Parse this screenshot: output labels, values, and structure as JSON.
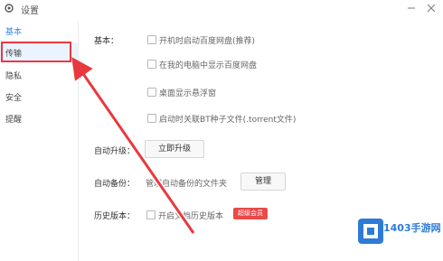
{
  "window": {
    "title": "设置"
  },
  "sidebar": {
    "items": [
      {
        "label": "基本"
      },
      {
        "label": "传输"
      },
      {
        "label": "隐私"
      },
      {
        "label": "安全"
      },
      {
        "label": "提醒"
      }
    ]
  },
  "basic": {
    "label": "基本：",
    "options": [
      {
        "text": "开机时启动百度网盘(推荐)"
      },
      {
        "text": "在我的电脑中显示百度网盘"
      },
      {
        "text": "桌面显示悬浮窗"
      },
      {
        "text": "启动时关联BT种子文件(.torrent文件)"
      }
    ]
  },
  "auto_upgrade": {
    "label": "自动升级：",
    "button": "立即升级"
  },
  "auto_backup": {
    "label": "自动备份：",
    "text": "管理自动备份的文件夹",
    "button": "管理"
  },
  "history": {
    "label": "历史版本：",
    "option": "开启文档历史版本",
    "tag": "超级会员"
  },
  "watermark": {
    "text": "1403手游网"
  },
  "colors": {
    "accent": "#3a8ee6",
    "callout": "#e8393f",
    "tag": "#e84a4a"
  }
}
